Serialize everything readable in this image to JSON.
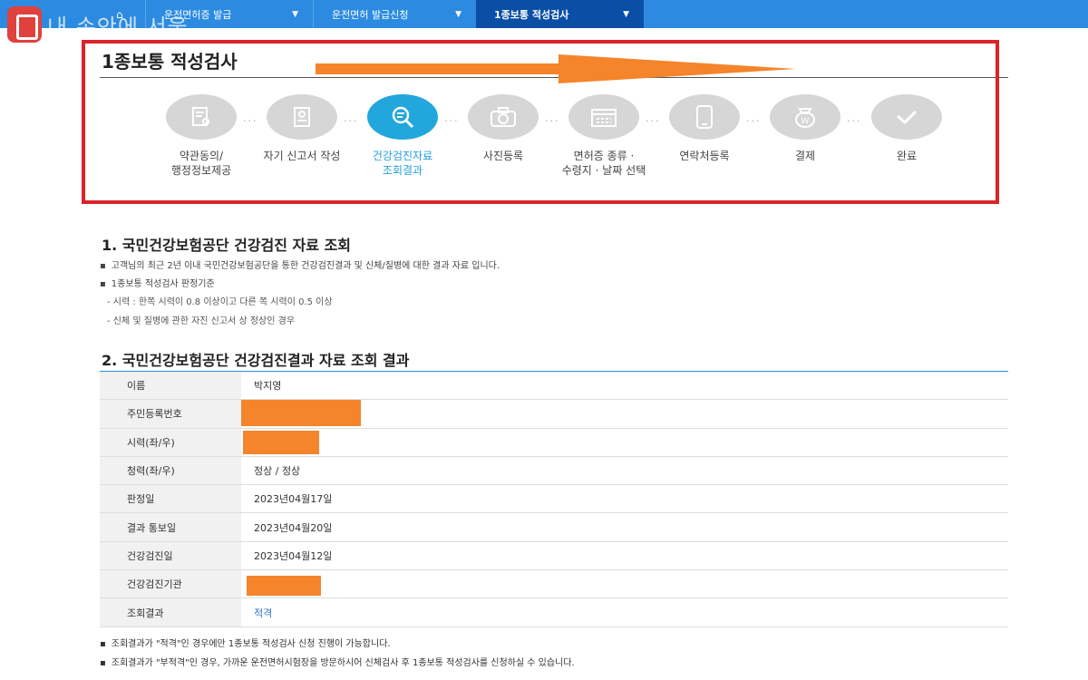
{
  "app": {
    "logo_text": "내 손안에 서울"
  },
  "nav": {
    "tabs": [
      {
        "label": "운전면허증 발급",
        "active": false
      },
      {
        "label": "운전면허 발급신청",
        "active": false
      },
      {
        "label": "1종보통 적성검사",
        "active": true
      }
    ]
  },
  "page": {
    "title": "1종보통 적성검사"
  },
  "steps": [
    {
      "label": "약관동의/\n행정정보제공",
      "icon": "document-search-icon",
      "active": false
    },
    {
      "label": "자기 신고서 작성",
      "icon": "form-icon",
      "active": false
    },
    {
      "label": "건강검진자료\n조회결과",
      "icon": "search-icon",
      "active": true
    },
    {
      "label": "사진등록",
      "icon": "camera-icon",
      "active": false
    },
    {
      "label": "면허증 종류 ·\n수령지 · 날짜 선택",
      "icon": "calendar-icon",
      "active": false
    },
    {
      "label": "연락처등록",
      "icon": "phone-icon",
      "active": false
    },
    {
      "label": "결제",
      "icon": "payment-icon",
      "active": false
    },
    {
      "label": "완료",
      "icon": "check-icon",
      "active": false
    }
  ],
  "section1": {
    "title": "1. 국민건강보험공단 건강검진 자료 조회",
    "bullets": [
      "고객님의 최근 2년 이내 국민건강보험공단을 통한 건강검진결과 및 신체/질병에 대한 결과 자료 입니다.",
      "1종보통 적성검사 판정기준"
    ],
    "subs": [
      "- 시력 : 한쪽 시력이 0.8 이상이고 다른 쪽 시력이 0.5 이상",
      "- 신체 및 질병에 관한 자진 신고서 상 정상인 경우"
    ]
  },
  "section2": {
    "title": "2. 국민건강보험공단 건강검진결과 자료 조회 결과",
    "rows": [
      {
        "label": "이름",
        "value": "박지영",
        "redacted": false
      },
      {
        "label": "주민등록번호",
        "value": "",
        "redacted": true
      },
      {
        "label": "시력(좌/우)",
        "value": "",
        "redacted": true
      },
      {
        "label": "청력(좌/우)",
        "value": "정상 / 정상",
        "redacted": false
      },
      {
        "label": "판정일",
        "value": "2023년04월17일",
        "redacted": false
      },
      {
        "label": "결과 통보일",
        "value": "2023년04월20일",
        "redacted": false
      },
      {
        "label": "건강검진일",
        "value": "2023년04월12일",
        "redacted": false
      },
      {
        "label": "건강검진기관",
        "value": "",
        "redacted": true
      },
      {
        "label": "조회결과",
        "value": "적격",
        "redacted": false
      }
    ]
  },
  "notes": [
    "조회결과가 \"적격\"인 경우에만 1종보통 적성검사 신청 진행이 가능합니다.",
    "조회결과가 \"부적격\"인 경우, 가까운 운전면허시험장을 방문하시어 신체검사 후 1종보통 적성검사를 신청하실 수 있습니다."
  ],
  "colors": {
    "nav": "#2c8be0",
    "nav_active": "#0a4ea6",
    "active_step": "#21a7dc",
    "highlight_box": "#d8242a",
    "arrow": "#f5842a",
    "redaction": "#f5842a"
  }
}
